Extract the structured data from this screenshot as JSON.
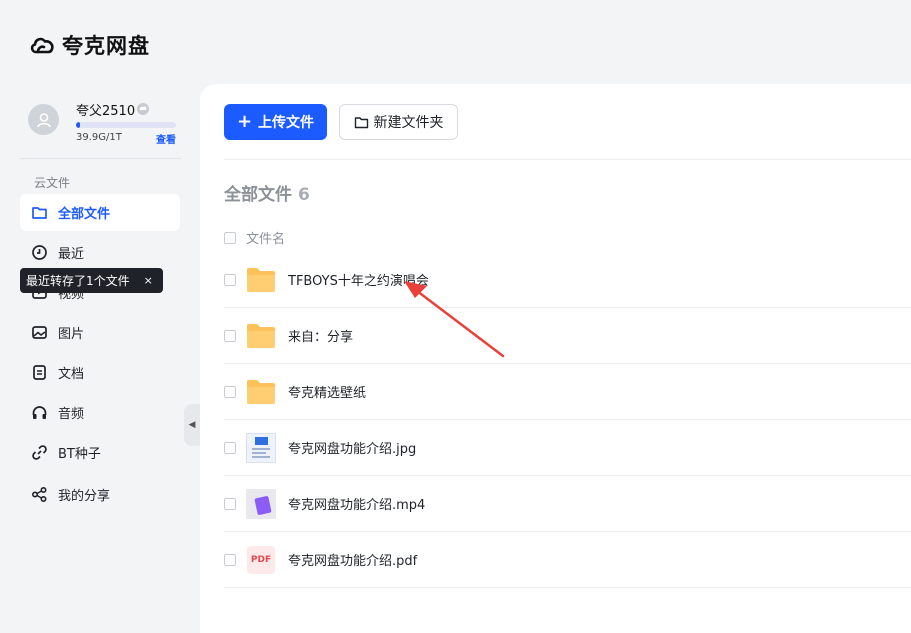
{
  "app": {
    "name": "夸克网盘"
  },
  "user": {
    "name": "夸父2510",
    "storage_text": "39.9G/1T",
    "storage_link": "查看",
    "storage_fraction": 0.04
  },
  "sidebar": {
    "section_label": "云文件",
    "items": [
      {
        "label": "全部文件",
        "icon": "folder-icon",
        "active": true
      },
      {
        "label": "最近",
        "icon": "clock-icon"
      },
      {
        "label": "视频",
        "icon": "video-icon"
      },
      {
        "label": "图片",
        "icon": "image-icon"
      },
      {
        "label": "文档",
        "icon": "document-icon"
      },
      {
        "label": "音频",
        "icon": "headphones-icon"
      },
      {
        "label": "BT种子",
        "icon": "link-icon"
      },
      {
        "label": "我的分享",
        "icon": "share-icon"
      }
    ],
    "tooltip": {
      "text": "最近转存了1个文件",
      "close": "×"
    }
  },
  "toolbar": {
    "upload_label": "上传文件",
    "upload_icon": "+",
    "new_folder_label": "新建文件夹"
  },
  "main": {
    "title": "全部文件",
    "count": "6",
    "column_header": "文件名",
    "files": [
      {
        "name": "TFBOYS十年之约演唱会",
        "type": "folder"
      },
      {
        "name": "来自：分享",
        "type": "folder"
      },
      {
        "name": "夸克精选壁纸",
        "type": "folder"
      },
      {
        "name": "夸克网盘功能介绍.jpg",
        "type": "image"
      },
      {
        "name": "夸克网盘功能介绍.mp4",
        "type": "video"
      },
      {
        "name": "夸克网盘功能介绍.pdf",
        "type": "pdf",
        "thumb_text": "PDF"
      }
    ]
  },
  "colors": {
    "accent": "#1b5bff",
    "folder": "#ffc15a",
    "annotation_arrow": "#e8413a"
  }
}
